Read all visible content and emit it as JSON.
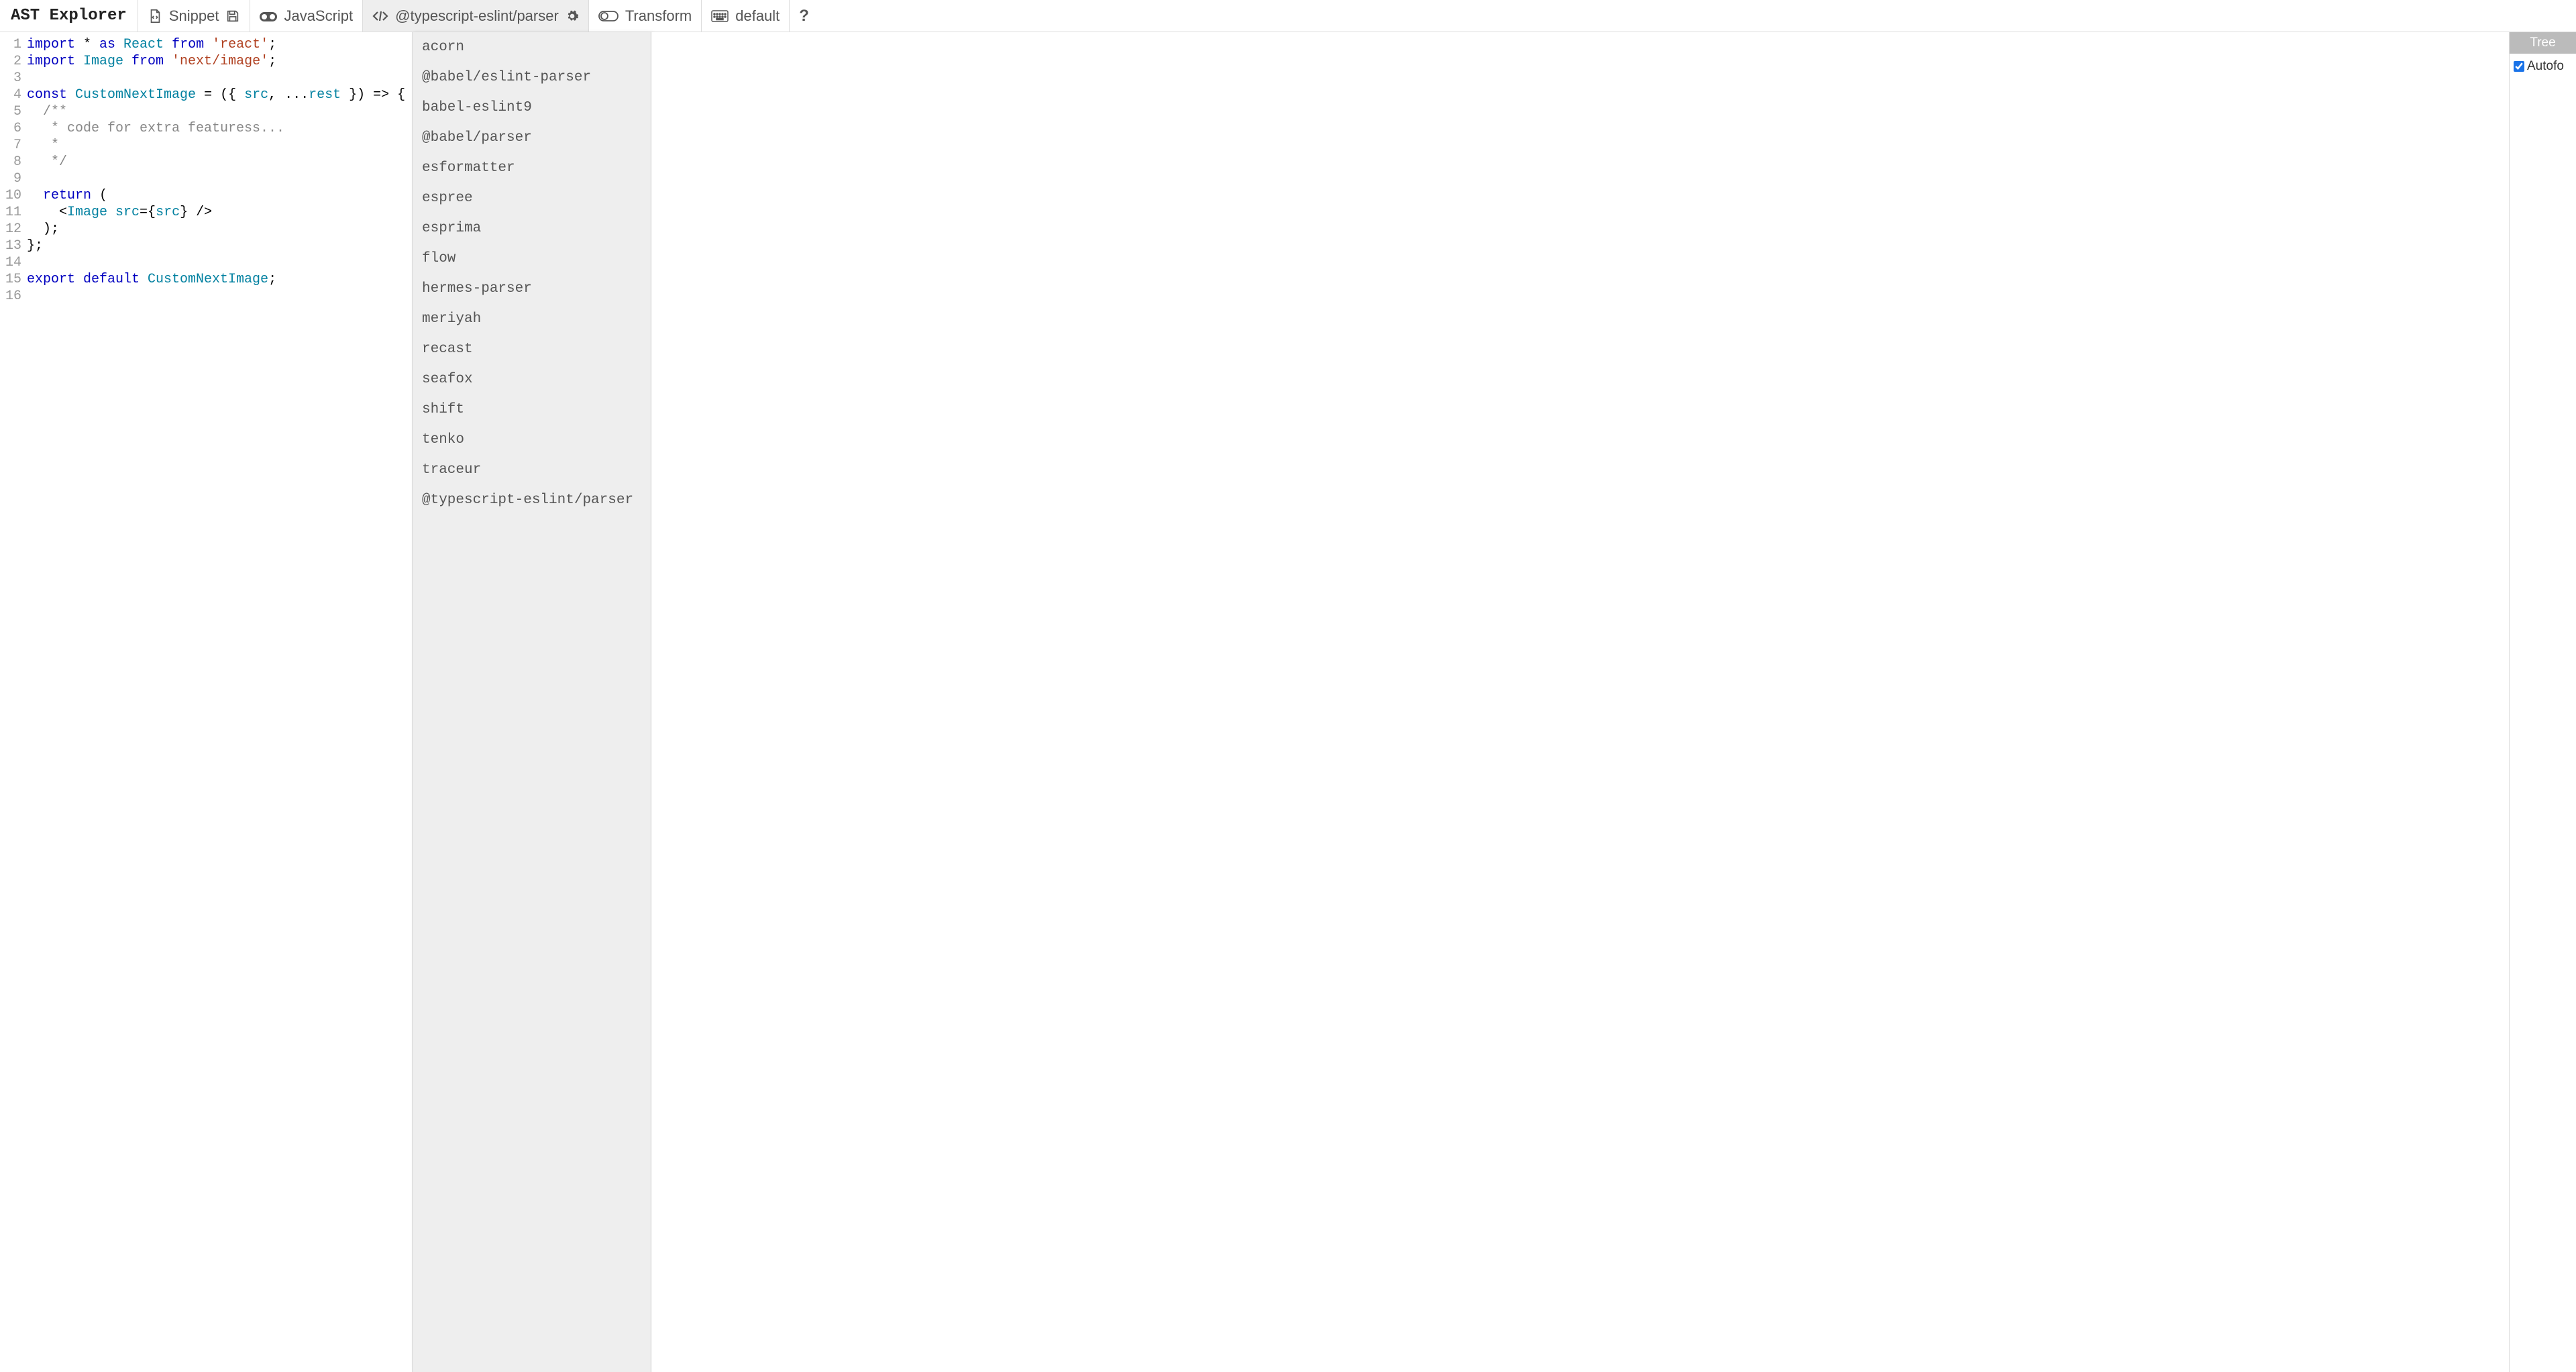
{
  "logo": "AST Explorer",
  "toolbar": {
    "snippet": "Snippet",
    "language": "JavaScript",
    "parser": "@typescript-eslint/parser",
    "transform": "Transform",
    "default": "default"
  },
  "help": "?",
  "parser_dropdown": [
    "acorn",
    "@babel/eslint-parser",
    "babel-eslint9",
    "@babel/parser",
    "esformatter",
    "espree",
    "esprima",
    "flow",
    "hermes-parser",
    "meriyah",
    "recast",
    "seafox",
    "shift",
    "tenko",
    "traceur",
    "@typescript-eslint/parser"
  ],
  "right_panel": {
    "tab_tree": "Tree",
    "autofocus": "Autofo"
  },
  "code": {
    "line1": {
      "kw1": "import",
      "star": " * ",
      "kw2": "as",
      "ident": " React ",
      "kw3": "from",
      "str": " 'react'",
      "end": ";"
    },
    "line2": {
      "kw1": "import",
      "ident": " Image ",
      "kw2": "from",
      "str": " 'next/image'",
      "end": ";"
    },
    "line4": {
      "kw1": "const",
      "ident": " CustomNextImage ",
      "mid": "= ({ ",
      "p1": "src",
      "rest": ", ...",
      "p2": "rest",
      "end": " }) => {"
    },
    "line5": "  /**",
    "line6": "   * code for extra featuress...",
    "line7": "   *",
    "line8": "   */",
    "line10": {
      "kw": "  return",
      "end": " ("
    },
    "line11": {
      "open": "    <",
      "tag": "Image",
      "attr": " src",
      "eq": "={",
      "val": "src",
      "close": "} />"
    },
    "line12": "  );",
    "line13": "};",
    "line15": {
      "kw1": "export",
      "kw2": " default",
      "ident": " CustomNextImage",
      "end": ";"
    }
  }
}
